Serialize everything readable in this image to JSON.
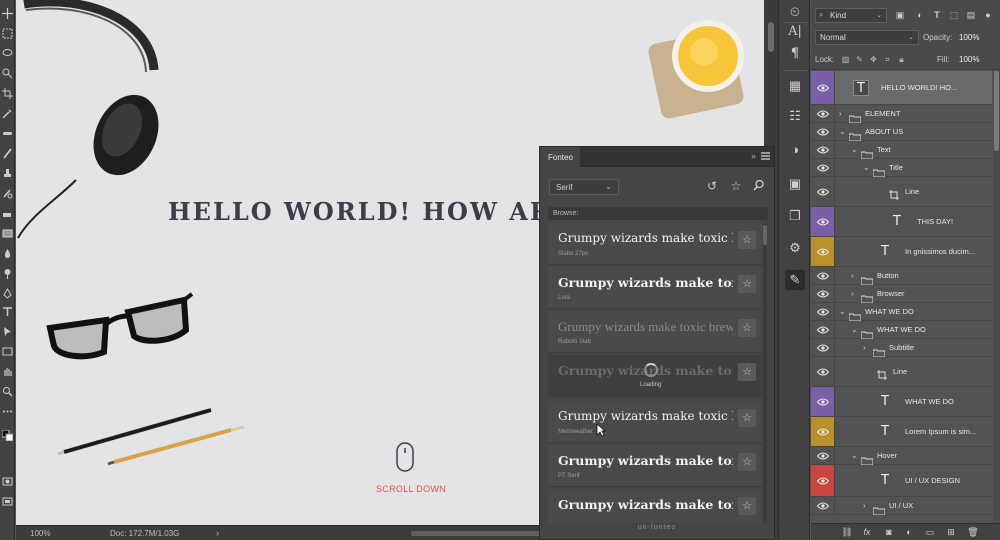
{
  "canvas": {
    "headline": "HELLO WORLD! HOW AR",
    "scroll_label": "SCROLL DOWN"
  },
  "status_bar": {
    "zoom": "100%",
    "doc_size": "Doc: 172.7M/1.03G",
    "arrow": "›"
  },
  "fonteo": {
    "tab_label": "Fonteo",
    "collapse_glyph": "»",
    "filter_value": "Serif",
    "browse_heading": "Browse:",
    "loading_label": "Loading",
    "footer": "un-fonteo",
    "fonts": [
      {
        "sample": "Grumpy wizards make toxic brew",
        "name": "Slabo 27px",
        "style": "regular",
        "state": "normal"
      },
      {
        "sample": "Grumpy wizards make toxic brew",
        "name": "Lora",
        "style": "bold",
        "state": "normal"
      },
      {
        "sample": "Grumpy wizards make toxic brew",
        "name": "Roboto Slab",
        "style": "light",
        "state": "dim"
      },
      {
        "sample": "Grumpy wizards make toxic brew",
        "name": "",
        "style": "bold",
        "state": "loading"
      },
      {
        "sample": "Grumpy wizards make toxic brew",
        "name": "Merriweather",
        "style": "regular",
        "state": "normal"
      },
      {
        "sample": "Grumpy wizards make toxic brew",
        "name": "PT Serif",
        "style": "bold",
        "state": "normal"
      },
      {
        "sample": "Grumpy wizards make toxic brew",
        "name": "",
        "style": "bold",
        "state": "normal"
      }
    ]
  },
  "layers_panel": {
    "kind_label": "Kind",
    "blend_mode": "Normal",
    "opacity_label": "Opacity:",
    "opacity_value": "100%",
    "lock_label": "Lock:",
    "fill_label": "Fill:",
    "fill_value": "100%",
    "rows": [
      {
        "name": "HELLO WORLD! HO...",
        "type": "text",
        "indent": 0,
        "color": "purple",
        "selected": true,
        "height": 34
      },
      {
        "name": "ELEMENT",
        "type": "group",
        "indent": 0,
        "expanded": false,
        "height": 18
      },
      {
        "name": "ABOUT US",
        "type": "group",
        "indent": 0,
        "expanded": true,
        "height": 18
      },
      {
        "name": "Text",
        "type": "group",
        "indent": 1,
        "expanded": true,
        "height": 18
      },
      {
        "name": "Title",
        "type": "group",
        "indent": 2,
        "expanded": true,
        "height": 18
      },
      {
        "name": "Line",
        "type": "shape",
        "indent": 3,
        "height": 30
      },
      {
        "name": "THIS DAY!",
        "type": "text",
        "indent": 3,
        "color": "purple",
        "height": 30
      },
      {
        "name": "In gnissimos ducim...",
        "type": "text",
        "indent": 2,
        "color": "gold",
        "height": 30
      },
      {
        "name": "Button",
        "type": "group",
        "indent": 1,
        "expanded": false,
        "height": 18
      },
      {
        "name": "Browser",
        "type": "group",
        "indent": 1,
        "expanded": false,
        "height": 18
      },
      {
        "name": "WHAT WE DO",
        "type": "group",
        "indent": 0,
        "expanded": true,
        "height": 18
      },
      {
        "name": "WHAT WE DO",
        "type": "group",
        "indent": 1,
        "expanded": true,
        "height": 18
      },
      {
        "name": "Subtitle",
        "type": "group",
        "indent": 2,
        "expanded": false,
        "height": 18
      },
      {
        "name": "Line",
        "type": "shape",
        "indent": 2,
        "height": 30
      },
      {
        "name": "WHAT WE DO",
        "type": "text",
        "indent": 2,
        "color": "purple",
        "height": 30
      },
      {
        "name": "Lorem Ipsum is sim...",
        "type": "text",
        "indent": 2,
        "color": "gold",
        "height": 30
      },
      {
        "name": "Hover",
        "type": "group",
        "indent": 1,
        "expanded": true,
        "height": 18
      },
      {
        "name": "UI / UX DESIGN",
        "type": "text",
        "indent": 2,
        "color": "red",
        "height": 32
      },
      {
        "name": "UI / UX",
        "type": "group",
        "indent": 2,
        "expanded": false,
        "height": 18
      }
    ]
  },
  "colors": {
    "accent_red": "#e2534c",
    "label_purple": "#7b5ea8",
    "label_gold": "#b8912c",
    "label_red": "#c9453f"
  }
}
